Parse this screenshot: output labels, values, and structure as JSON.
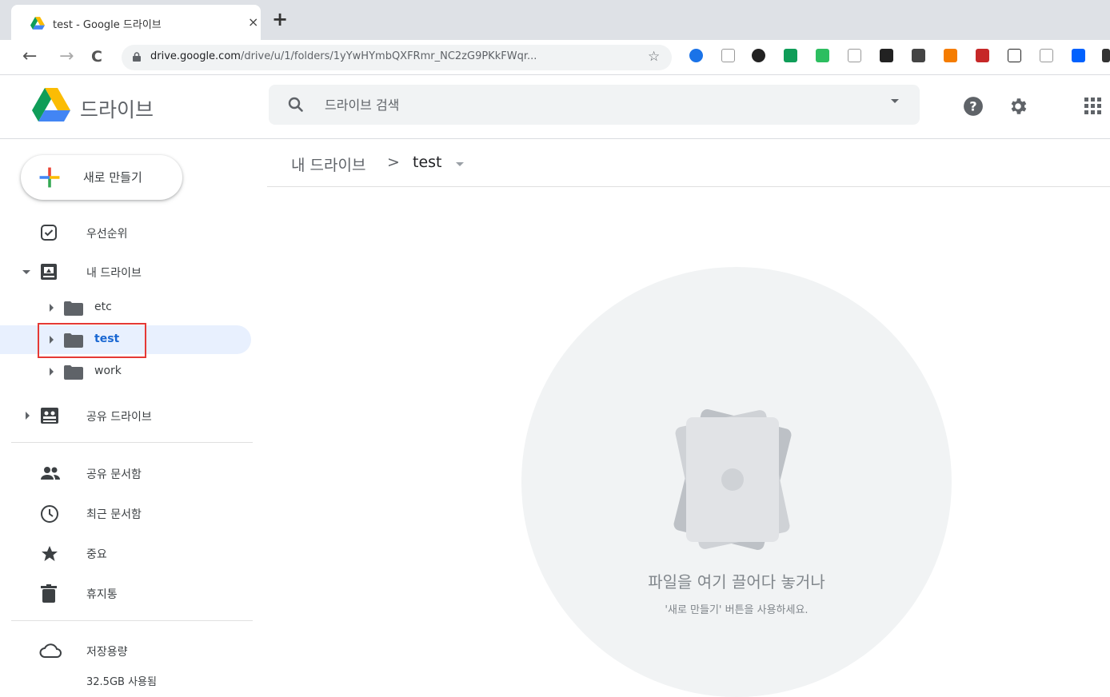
{
  "browser": {
    "tab_title": "test - Google 드라이브",
    "tab_close": "×",
    "new_tab": "+",
    "url_host": "drive.google.com",
    "url_path": "/drive/u/1/folders/1yYwHYmbQXFRmr_NC2zG9PKkFWqr...",
    "back": "←",
    "forward": "→",
    "reload": "C",
    "bookmark_star": "☆",
    "extensions": [
      "ext-1",
      "ext-2",
      "ext-3",
      "ext-4",
      "ext-5",
      "ext-6",
      "ext-7",
      "ext-8",
      "ext-9",
      "ext-10",
      "ext-11",
      "ext-12",
      "ext-13",
      "ext-14",
      "ext-15"
    ]
  },
  "header": {
    "app_name": "드라이브",
    "search_placeholder": "드라이브 검색"
  },
  "sidebar": {
    "new_label": "새로 만들기",
    "priority": "우선순위",
    "my_drive": "내 드라이브",
    "folders": [
      "etc",
      "test",
      "work"
    ],
    "shared_drives": "공유 드라이브",
    "shared_with_me": "공유 문서함",
    "recent": "최근 문서함",
    "starred": "중요",
    "trash": "휴지통",
    "storage": "저장용량",
    "storage_used": "32.5GB 사용됨"
  },
  "main": {
    "breadcrumb_root": "내 드라이브",
    "breadcrumb_sep": ">",
    "breadcrumb_current": "test",
    "empty_title": "파일을 여기 끌어다 놓거나",
    "empty_subtitle": "'새로 만들기' 버튼을 사용하세요."
  },
  "colors": {
    "accent_blue": "#1967d2",
    "selected_bg": "#e8f0fe",
    "highlight_box": "#e53935"
  }
}
